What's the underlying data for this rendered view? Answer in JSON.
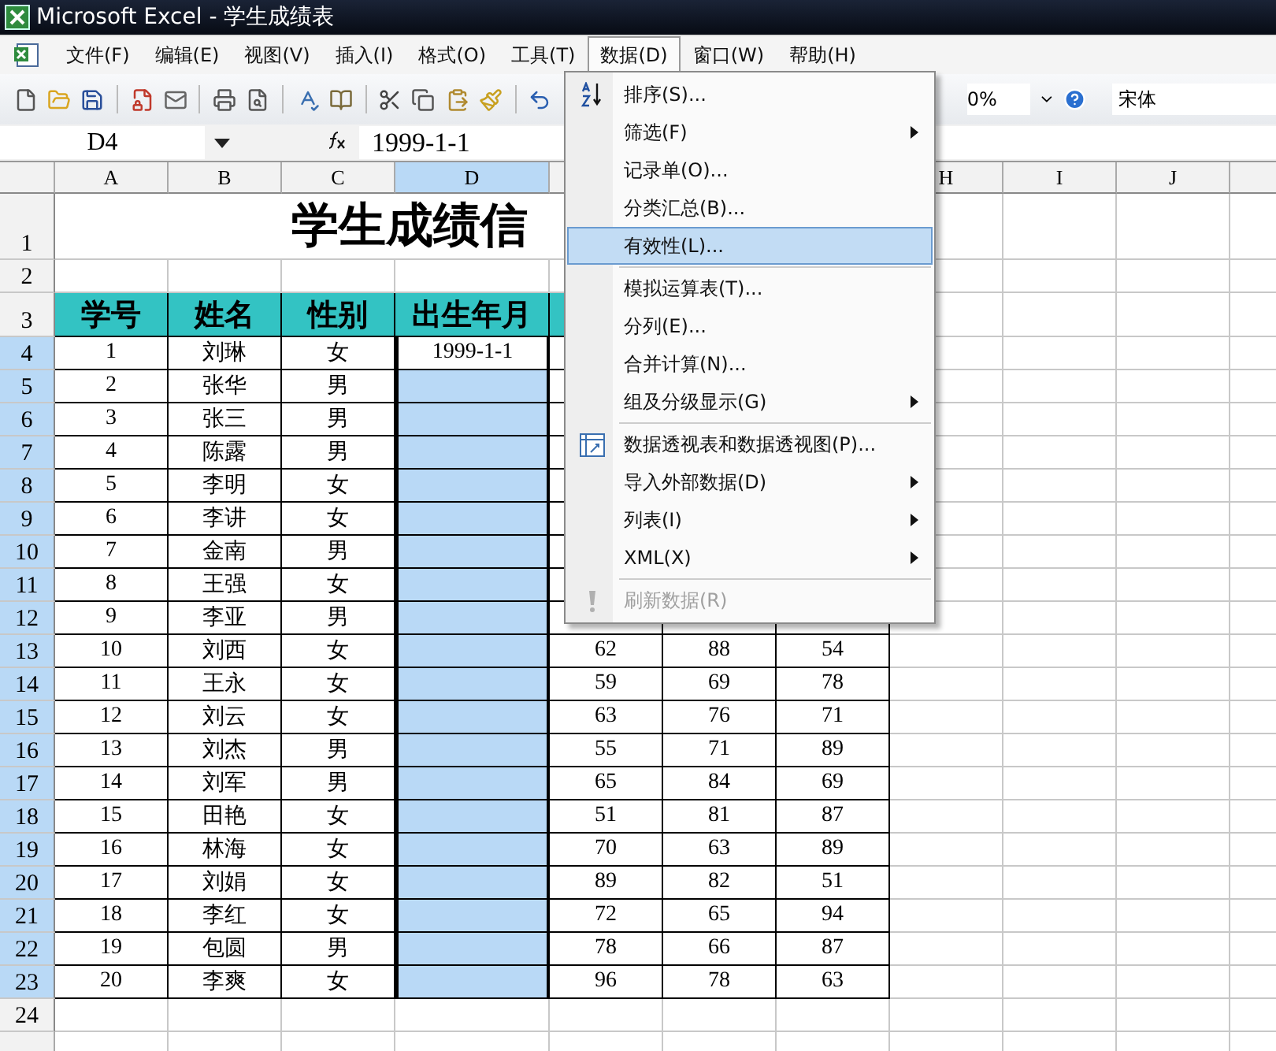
{
  "window": {
    "title": "Microsoft Excel - 学生成绩表"
  },
  "menu_bar": [
    {
      "label": "文件(F)",
      "selected": false
    },
    {
      "label": "编辑(E)",
      "selected": false
    },
    {
      "label": "视图(V)",
      "selected": false
    },
    {
      "label": "插入(I)",
      "selected": false
    },
    {
      "label": "格式(O)",
      "selected": false
    },
    {
      "label": "工具(T)",
      "selected": false
    },
    {
      "label": "数据(D)",
      "selected": true
    },
    {
      "label": "窗口(W)",
      "selected": false
    },
    {
      "label": "帮助(H)",
      "selected": false
    }
  ],
  "toolbar": {
    "zoom": "0%",
    "font": "宋体"
  },
  "formula_bar": {
    "name_box": "D4",
    "formula": "1999-1-1"
  },
  "data_menu": [
    {
      "label": "排序(S)...",
      "kind": "item",
      "selected": false,
      "disabled": false
    },
    {
      "label": "筛选(F)",
      "kind": "submenu",
      "selected": false,
      "disabled": false
    },
    {
      "label": "记录单(O)...",
      "kind": "item",
      "selected": false,
      "disabled": false
    },
    {
      "label": "分类汇总(B)...",
      "kind": "item",
      "selected": false,
      "disabled": false
    },
    {
      "label": "有效性(L)...",
      "kind": "item",
      "selected": true,
      "disabled": false
    },
    {
      "kind": "separator"
    },
    {
      "label": "模拟运算表(T)...",
      "kind": "item",
      "selected": false,
      "disabled": false
    },
    {
      "label": "分列(E)...",
      "kind": "item",
      "selected": false,
      "disabled": false
    },
    {
      "label": "合并计算(N)...",
      "kind": "item",
      "selected": false,
      "disabled": false
    },
    {
      "label": "组及分级显示(G)",
      "kind": "submenu",
      "selected": false,
      "disabled": false
    },
    {
      "kind": "separator"
    },
    {
      "label": "数据透视表和数据透视图(P)...",
      "kind": "item",
      "selected": false,
      "disabled": false
    },
    {
      "label": "导入外部数据(D)",
      "kind": "submenu",
      "selected": false,
      "disabled": false
    },
    {
      "label": "列表(I)",
      "kind": "submenu",
      "selected": false,
      "disabled": false
    },
    {
      "label": "XML(X)",
      "kind": "submenu",
      "selected": false,
      "disabled": false
    },
    {
      "kind": "separator"
    },
    {
      "label": "刷新数据(R)",
      "kind": "item",
      "selected": false,
      "disabled": true
    }
  ],
  "sheet": {
    "columns": [
      {
        "label": "A",
        "selected": false
      },
      {
        "label": "B",
        "selected": false
      },
      {
        "label": "C",
        "selected": false
      },
      {
        "label": "D",
        "selected": true
      },
      {
        "label": "H",
        "selected": false
      },
      {
        "label": "I",
        "selected": false
      },
      {
        "label": "J",
        "selected": false
      }
    ],
    "title_row": {
      "header": "1",
      "title": "学生成绩信"
    },
    "blank_row": {
      "header": "2"
    },
    "table_header": {
      "header": "3",
      "cells": [
        "学号",
        "姓名",
        "性别",
        "出生年月"
      ]
    },
    "rows": [
      {
        "header": "4",
        "selected": true,
        "cells": [
          "1",
          "刘琳",
          "女",
          "1999-1-1"
        ]
      },
      {
        "header": "5",
        "selected": true,
        "cells": [
          "2",
          "张华",
          "男",
          ""
        ]
      },
      {
        "header": "6",
        "selected": true,
        "cells": [
          "3",
          "张三",
          "男",
          ""
        ]
      },
      {
        "header": "7",
        "selected": true,
        "cells": [
          "4",
          "陈露",
          "男",
          ""
        ]
      },
      {
        "header": "8",
        "selected": true,
        "cells": [
          "5",
          "李明",
          "女",
          ""
        ]
      },
      {
        "header": "9",
        "selected": true,
        "cells": [
          "6",
          "李讲",
          "女",
          ""
        ]
      },
      {
        "header": "10",
        "selected": true,
        "cells": [
          "7",
          "金南",
          "男",
          ""
        ]
      },
      {
        "header": "11",
        "selected": true,
        "cells": [
          "8",
          "王强",
          "女",
          ""
        ]
      },
      {
        "header": "12",
        "selected": true,
        "cells": [
          "9",
          "李亚",
          "男",
          ""
        ]
      },
      {
        "header": "13",
        "selected": true,
        "cells": [
          "10",
          "刘西",
          "女",
          "",
          "62",
          "88",
          "54"
        ]
      },
      {
        "header": "14",
        "selected": true,
        "cells": [
          "11",
          "王永",
          "女",
          "",
          "59",
          "69",
          "78"
        ]
      },
      {
        "header": "15",
        "selected": true,
        "cells": [
          "12",
          "刘云",
          "女",
          "",
          "63",
          "76",
          "71"
        ]
      },
      {
        "header": "16",
        "selected": true,
        "cells": [
          "13",
          "刘杰",
          "男",
          "",
          "55",
          "71",
          "89"
        ]
      },
      {
        "header": "17",
        "selected": true,
        "cells": [
          "14",
          "刘军",
          "男",
          "",
          "65",
          "84",
          "69"
        ]
      },
      {
        "header": "18",
        "selected": true,
        "cells": [
          "15",
          "田艳",
          "女",
          "",
          "51",
          "81",
          "87"
        ]
      },
      {
        "header": "19",
        "selected": true,
        "cells": [
          "16",
          "林海",
          "女",
          "",
          "70",
          "63",
          "89"
        ]
      },
      {
        "header": "20",
        "selected": true,
        "cells": [
          "17",
          "刘娟",
          "女",
          "",
          "89",
          "82",
          "51"
        ]
      },
      {
        "header": "21",
        "selected": true,
        "cells": [
          "18",
          "李红",
          "女",
          "",
          "72",
          "65",
          "94"
        ]
      },
      {
        "header": "22",
        "selected": true,
        "cells": [
          "19",
          "包圆",
          "男",
          "",
          "78",
          "66",
          "87"
        ]
      },
      {
        "header": "23",
        "selected": true,
        "cells": [
          "20",
          "李爽",
          "女",
          "",
          "96",
          "78",
          "63"
        ]
      }
    ],
    "empty_rows": [
      {
        "header": "24"
      }
    ]
  }
}
